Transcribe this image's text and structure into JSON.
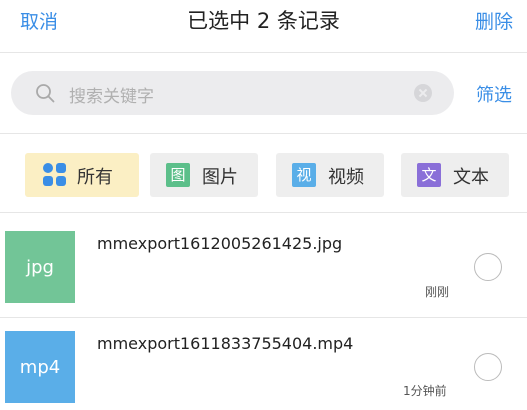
{
  "header": {
    "cancel_label": "取消",
    "title": "已选中 2 条记录",
    "delete_label": "删除"
  },
  "search": {
    "placeholder": "搜索关键字",
    "filter_label": "筛选"
  },
  "filters": [
    {
      "label": "所有",
      "icon": "grid-icon",
      "icon_text": "",
      "color": "#3a8ee6",
      "active": true
    },
    {
      "label": "图片",
      "icon": "image-icon",
      "icon_text": "图",
      "color": "#5cbf8a",
      "active": false
    },
    {
      "label": "视频",
      "icon": "video-icon",
      "icon_text": "视",
      "color": "#5aaee8",
      "active": false
    },
    {
      "label": "文本",
      "icon": "text-icon",
      "icon_text": "文",
      "color": "#8a6fd8",
      "active": false
    }
  ],
  "files": [
    {
      "thumb_label": "jpg",
      "thumb_color": "#72c597",
      "name": "mmexport1612005261425.jpg",
      "time": "刚刚"
    },
    {
      "thumb_label": "mp4",
      "thumb_color": "#5aaee8",
      "name": "mmexport1611833755404.mp4",
      "time": "1分钟前"
    }
  ],
  "colors": {
    "accent": "#3a8ee6",
    "active_chip_bg": "#fbefc4"
  }
}
